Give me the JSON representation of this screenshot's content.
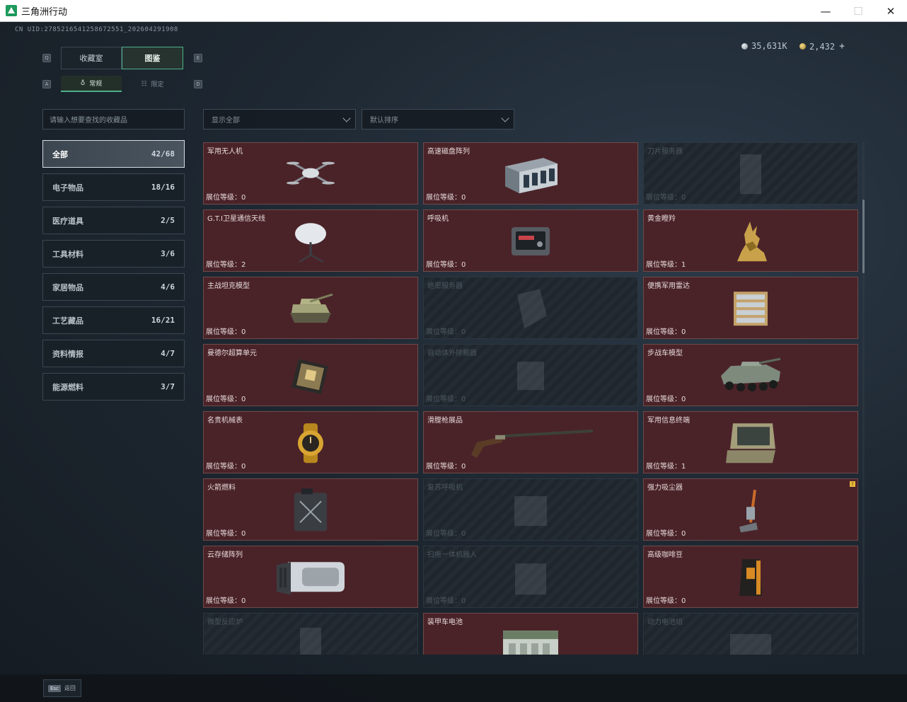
{
  "window": {
    "title": "三角洲行动",
    "minimize_icon": "—",
    "maximize_icon": "☐",
    "close_icon": "✕"
  },
  "header": {
    "uid": "CN UID:2785216541258672551_202604291908",
    "silver_amount": "35,631K",
    "gold_amount": "2,432",
    "plus_label": "+"
  },
  "key_hints": {
    "tab_left": "Q",
    "tab_right": "E",
    "sub_left": "A",
    "sub_right": "D"
  },
  "tabs": [
    {
      "label": "收藏室",
      "active": false
    },
    {
      "label": "图鉴",
      "active": true
    }
  ],
  "sub_tabs": [
    {
      "label": "常规",
      "icon": "♁",
      "active": true
    },
    {
      "label": "限定",
      "icon": "☷",
      "active": false
    }
  ],
  "search": {
    "placeholder": "请输入想要查找的收藏品"
  },
  "filters": {
    "display_label": "显示全部",
    "sort_label": "默认排序"
  },
  "categories": [
    {
      "label": "全部",
      "count": "42/68",
      "active": true
    },
    {
      "label": "电子物品",
      "count": "18/16"
    },
    {
      "label": "医疗道具",
      "count": "2/5"
    },
    {
      "label": "工具材料",
      "count": "3/6"
    },
    {
      "label": "家居物品",
      "count": "4/6"
    },
    {
      "label": "工艺藏品",
      "count": "16/21"
    },
    {
      "label": "资料情报",
      "count": "4/7"
    },
    {
      "label": "能源燃料",
      "count": "3/7"
    }
  ],
  "level_prefix": "展位等级：",
  "items": [
    {
      "name": "军用无人机",
      "level": "0",
      "locked": false,
      "icon": "drone-icon"
    },
    {
      "name": "高速磁盘阵列",
      "level": "0",
      "locked": false,
      "icon": "disk-array-icon"
    },
    {
      "name": "刀片服务器",
      "level": "0",
      "locked": true,
      "icon": "blade-server-icon"
    },
    {
      "name": "G.T.I卫星通信天线",
      "level": "2",
      "locked": false,
      "icon": "satellite-dish-icon"
    },
    {
      "name": "呼吸机",
      "level": "0",
      "locked": false,
      "icon": "ventilator-icon"
    },
    {
      "name": "黄金瞪羚",
      "level": "1",
      "locked": false,
      "icon": "gold-gazelle-icon"
    },
    {
      "name": "主战坦克模型",
      "level": "0",
      "locked": false,
      "icon": "tank-model-icon"
    },
    {
      "name": "绝密服务器",
      "level": "0",
      "locked": true,
      "icon": "server-icon"
    },
    {
      "name": "便携军用雷达",
      "level": "0",
      "locked": false,
      "icon": "radar-icon"
    },
    {
      "name": "曼德尔超算单元",
      "level": "0",
      "locked": false,
      "icon": "compute-unit-icon"
    },
    {
      "name": "自动体外除颤器",
      "level": "0",
      "locked": true,
      "icon": "defibrillator-icon"
    },
    {
      "name": "步战车模型",
      "level": "0",
      "locked": false,
      "icon": "ifv-model-icon"
    },
    {
      "name": "名贵机械表",
      "level": "0",
      "locked": false,
      "icon": "watch-icon"
    },
    {
      "name": "滑膛枪展品",
      "level": "0",
      "locked": false,
      "icon": "musket-icon"
    },
    {
      "name": "军用信息终端",
      "level": "1",
      "locked": false,
      "icon": "terminal-icon"
    },
    {
      "name": "火箭燃料",
      "level": "0",
      "locked": false,
      "icon": "fuel-can-icon"
    },
    {
      "name": "复苏呼吸机",
      "level": "0",
      "locked": true,
      "icon": "resuscitator-icon"
    },
    {
      "name": "强力吸尘器",
      "level": "0",
      "locked": false,
      "icon": "vacuum-icon",
      "badge": "!"
    },
    {
      "name": "云存储阵列",
      "level": "0",
      "locked": false,
      "icon": "cloud-storage-icon"
    },
    {
      "name": "扫拖一体机器人",
      "level": "0",
      "locked": true,
      "icon": "robot-mop-icon"
    },
    {
      "name": "高级咖啡豆",
      "level": "0",
      "locked": false,
      "icon": "coffee-bag-icon"
    },
    {
      "name": "微型反应炉",
      "level": "",
      "locked": true,
      "icon": "reactor-icon"
    },
    {
      "name": "装甲车电池",
      "level": "",
      "locked": false,
      "icon": "battery-icon"
    },
    {
      "name": "动力电池组",
      "level": "",
      "locked": true,
      "icon": "battery-pack-icon"
    }
  ],
  "footer": {
    "esc_key": "Esc",
    "esc_label": "返回"
  }
}
